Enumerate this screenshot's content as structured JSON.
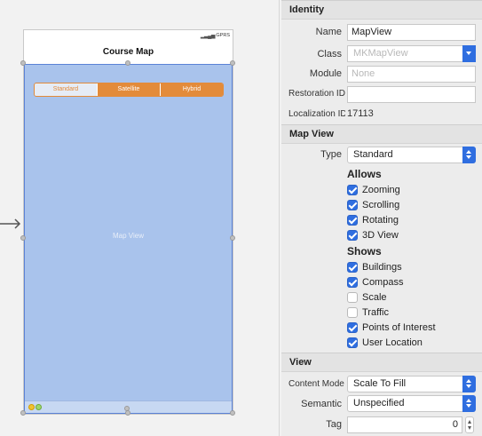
{
  "canvas": {
    "status_signal": "▕▖▗▘",
    "status_carrier": "GPRS",
    "nav_title": "Course Map",
    "segments": [
      "Standard",
      "Satellite",
      "Hybrid"
    ],
    "selected_segment": 0,
    "map_label": "Map View",
    "accent_color": "#e38b3a",
    "map_fill_color": "#a9c3ec"
  },
  "inspector": {
    "identity": {
      "header": "Identity",
      "name_label": "Name",
      "name_value": "MapView",
      "class_label": "Class",
      "class_placeholder": "MKMapView",
      "module_label": "Module",
      "module_placeholder": "None",
      "restoration_label": "Restoration ID",
      "restoration_value": "",
      "localization_label": "Localization ID",
      "localization_value": "17113"
    },
    "map_view": {
      "header": "Map View",
      "type_label": "Type",
      "type_value": "Standard",
      "allows_title": "Allows",
      "allows": [
        {
          "label": "Zooming",
          "checked": true
        },
        {
          "label": "Scrolling",
          "checked": true
        },
        {
          "label": "Rotating",
          "checked": true
        },
        {
          "label": "3D View",
          "checked": true
        }
      ],
      "shows_title": "Shows",
      "shows": [
        {
          "label": "Buildings",
          "checked": true
        },
        {
          "label": "Compass",
          "checked": true
        },
        {
          "label": "Scale",
          "checked": false
        },
        {
          "label": "Traffic",
          "checked": false
        },
        {
          "label": "Points of Interest",
          "checked": true
        },
        {
          "label": "User Location",
          "checked": true
        }
      ]
    },
    "view": {
      "header": "View",
      "content_mode_label": "Content Mode",
      "content_mode_value": "Scale To Fill",
      "semantic_label": "Semantic",
      "semantic_value": "Unspecified",
      "tag_label": "Tag",
      "tag_value": "0"
    },
    "checkbox_color": "#2f6ee0"
  }
}
